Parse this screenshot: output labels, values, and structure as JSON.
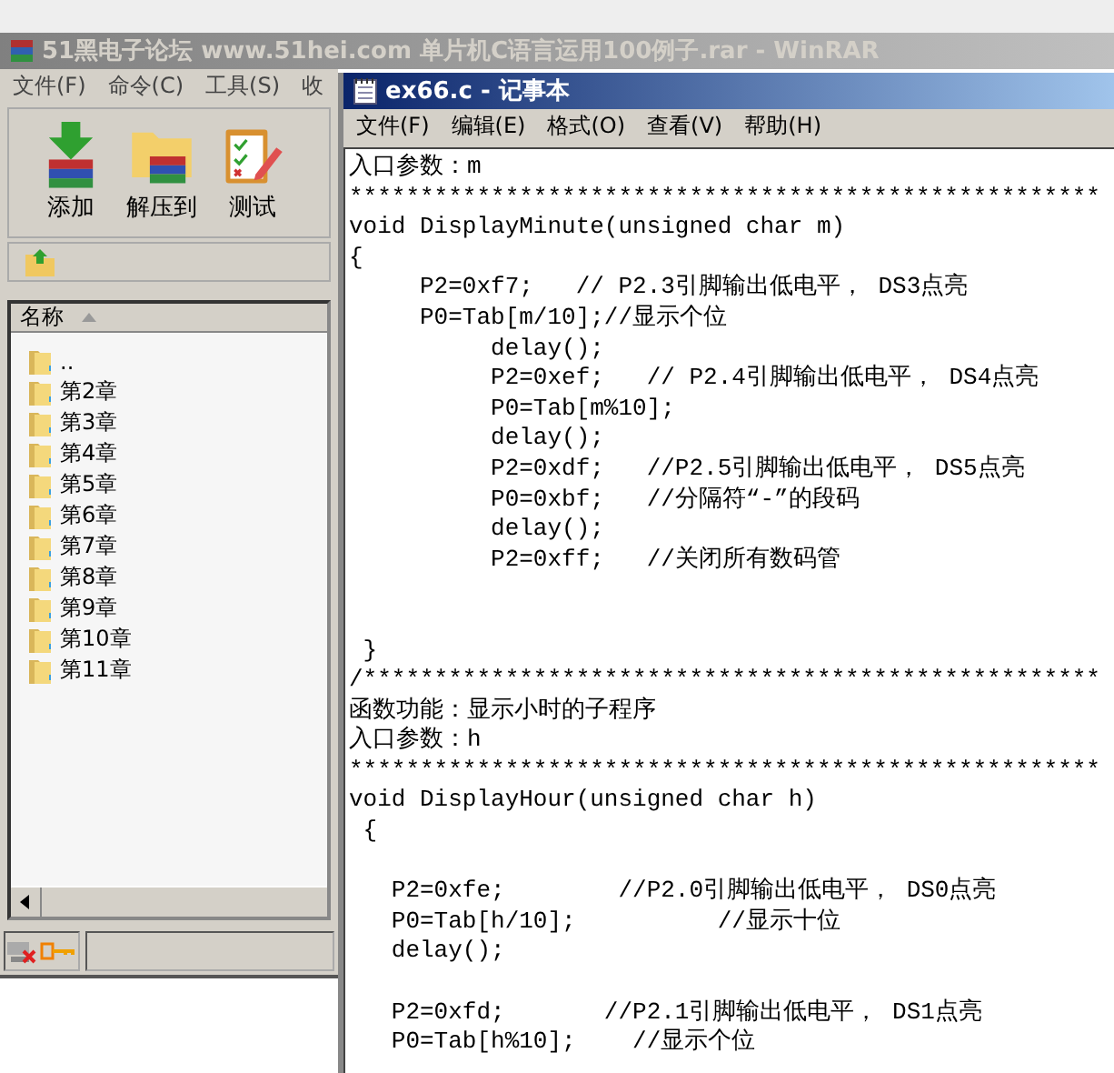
{
  "winrar": {
    "title": "51黑电子论坛 www.51hei.com 单片机C语言运用100例子.rar - WinRAR",
    "menu": [
      "文件(F)",
      "命令(C)",
      "工具(S)",
      "收"
    ],
    "toolbar": [
      {
        "label": "添加",
        "kind": "add"
      },
      {
        "label": "解压到",
        "kind": "extract"
      },
      {
        "label": "测试",
        "kind": "test"
      }
    ],
    "list": {
      "columns": [
        "名称"
      ],
      "rows": [
        {
          "name": ".."
        },
        {
          "name": "第2章"
        },
        {
          "name": "第3章"
        },
        {
          "name": "第4章"
        },
        {
          "name": "第5章"
        },
        {
          "name": "第6章"
        },
        {
          "name": "第7章"
        },
        {
          "name": "第8章"
        },
        {
          "name": "第9章"
        },
        {
          "name": "第10章"
        },
        {
          "name": "第11章"
        }
      ]
    }
  },
  "notepad": {
    "title": "ex66.c - 记事本",
    "menu": [
      "文件(F)",
      "编辑(E)",
      "格式(O)",
      "查看(V)",
      "帮助(H)"
    ],
    "lines": [
      {
        "kind": "code",
        "text": "入口参数：m"
      },
      {
        "kind": "code",
        "text": "*****************************************************"
      },
      {
        "kind": "code",
        "text": "void DisplayMinute(unsigned char m)"
      },
      {
        "kind": "code",
        "text": "{"
      },
      {
        "kind": "code",
        "text": "     P2=0xf7;   // P2.3引脚输出低电平， DS3点亮"
      },
      {
        "kind": "code",
        "text": "     P0=Tab[m/10];//显示个位"
      },
      {
        "kind": "code",
        "text": "          delay();"
      },
      {
        "kind": "code",
        "text": "          P2=0xef;   // P2.4引脚输出低电平， DS4点亮"
      },
      {
        "kind": "code",
        "text": "          P0=Tab[m%10];"
      },
      {
        "kind": "code",
        "text": "          delay();"
      },
      {
        "kind": "code",
        "text": "          P2=0xdf;   //P2.5引脚输出低电平， DS5点亮"
      },
      {
        "kind": "code",
        "text": "          P0=0xbf;   //分隔符“-”的段码"
      },
      {
        "kind": "code",
        "text": "          delay();"
      },
      {
        "kind": "code",
        "text": "          P2=0xff;   //关闭所有数码管"
      },
      {
        "kind": "blank"
      },
      {
        "kind": "blank"
      },
      {
        "kind": "code",
        "text": " }"
      },
      {
        "kind": "code",
        "text": "/****************************************************"
      },
      {
        "kind": "code",
        "text": "函数功能：显示小时的子程序"
      },
      {
        "kind": "code",
        "text": "入口参数：h"
      },
      {
        "kind": "code",
        "text": "*****************************************************"
      },
      {
        "kind": "code",
        "text": "void DisplayHour(unsigned char h)"
      },
      {
        "kind": "code",
        "text": " {"
      },
      {
        "kind": "blank"
      },
      {
        "kind": "code",
        "text": "   P2=0xfe;        //P2.0引脚输出低电平， DS0点亮"
      },
      {
        "kind": "code",
        "text": "   P0=Tab[h/10];          //显示十位"
      },
      {
        "kind": "code",
        "text": "   delay();"
      },
      {
        "kind": "blank"
      },
      {
        "kind": "code",
        "text": "   P2=0xfd;       //P2.1引脚输出低电平， DS1点亮"
      },
      {
        "kind": "code",
        "text": "   P0=Tab[h%10];    //显示个位"
      }
    ]
  }
}
